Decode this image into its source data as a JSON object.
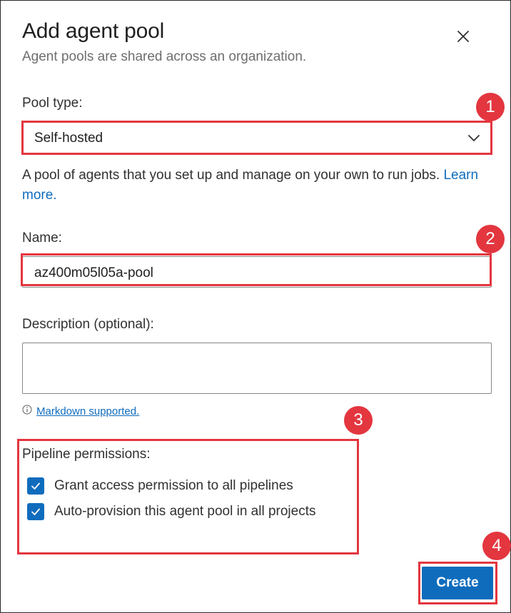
{
  "dialog": {
    "title": "Add agent pool",
    "subtitle": "Agent pools are shared across an organization."
  },
  "pool_type": {
    "label": "Pool type:",
    "value": "Self-hosted",
    "help_text": "A pool of agents that you set up and manage on your own to run jobs.",
    "learn_more": "Learn more."
  },
  "name": {
    "label": "Name:",
    "value": "az400m05l05a-pool"
  },
  "description": {
    "label": "Description (optional):",
    "value": "",
    "markdown_link": "Markdown supported."
  },
  "permissions": {
    "label": "Pipeline permissions:",
    "options": [
      {
        "label": "Grant access permission to all pipelines",
        "checked": true
      },
      {
        "label": "Auto-provision this agent pool in all projects",
        "checked": true
      }
    ]
  },
  "actions": {
    "create_label": "Create"
  },
  "annotations": [
    "1",
    "2",
    "3",
    "4"
  ],
  "colors": {
    "accent": "#0f6cbd",
    "annotation": "#e3363f"
  }
}
